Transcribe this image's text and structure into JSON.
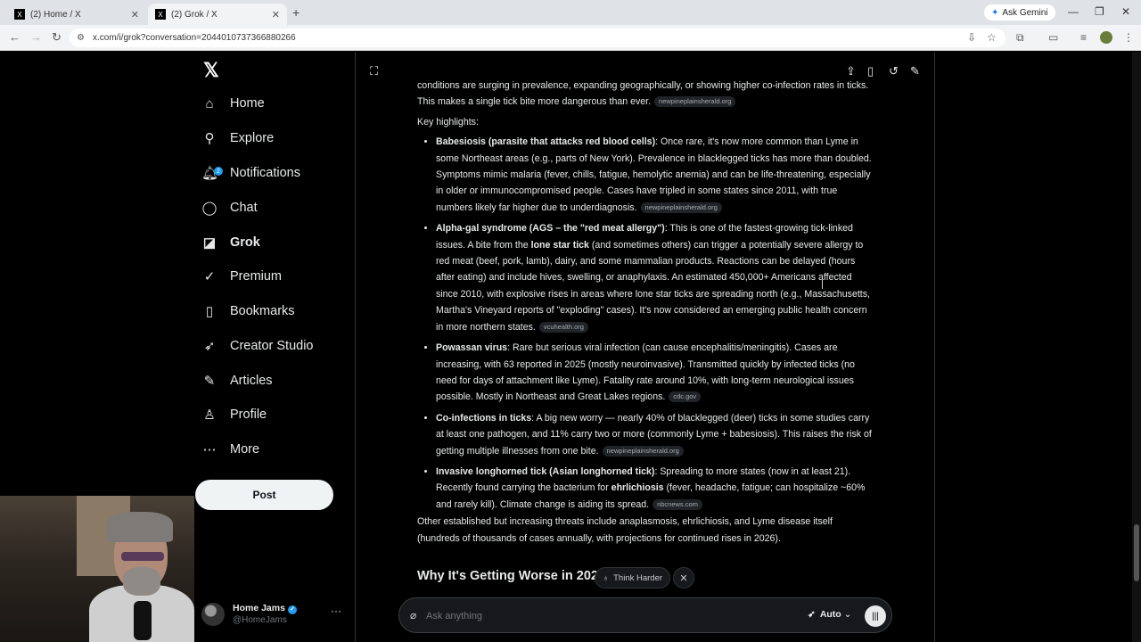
{
  "browser": {
    "tabs": [
      {
        "title": "(2) Home / X",
        "active": false
      },
      {
        "title": "(2) Grok / X",
        "active": true
      }
    ],
    "new_tab_icon": "plus-icon",
    "ask_gemini": "Ask Gemini",
    "url": "x.com/i/grok?conversation=2044010737366880266"
  },
  "sidebar": {
    "items": [
      {
        "label": "Home",
        "icon": "home-icon"
      },
      {
        "label": "Explore",
        "icon": "search-icon"
      },
      {
        "label": "Notifications",
        "icon": "bell-icon",
        "badge": "2"
      },
      {
        "label": "Chat",
        "icon": "chat-icon"
      },
      {
        "label": "Grok",
        "icon": "grok-icon"
      },
      {
        "label": "Premium",
        "icon": "premium-icon"
      },
      {
        "label": "Bookmarks",
        "icon": "bookmark-icon"
      },
      {
        "label": "Creator Studio",
        "icon": "rocket-icon"
      },
      {
        "label": "Articles",
        "icon": "article-icon"
      },
      {
        "label": "Profile",
        "icon": "person-icon"
      },
      {
        "label": "More",
        "icon": "more-icon"
      }
    ],
    "post_label": "Post",
    "profile": {
      "name": "Home Jams",
      "handle": "@HomeJams"
    }
  },
  "content": {
    "intro": "conditions are surging in prevalence, expanding geographically, or showing higher co-infection rates in ticks. This makes a single tick bite more dangerous than ever.",
    "intro_src": "newpineplainsherald.org",
    "key_highlights": "Key highlights:",
    "b1_bold": "Babesiosis (parasite that attacks red blood cells)",
    "b1_text": ": Once rare, it's now more common than Lyme in some Northeast areas (e.g., parts of New York). Prevalence in blacklegged ticks has more than doubled. Symptoms mimic malaria (fever, chills, fatigue, hemolytic anemia) and can be life-threatening, especially in older or immunocompromised people. Cases have tripled in some states since 2011, with true numbers likely far higher due to underdiagnosis.",
    "b1_src": "newpineplainsherald.org",
    "b2_bold": "Alpha-gal syndrome (AGS – the \"red meat allergy\")",
    "b2_text1": ": This is one of the fastest-growing tick-linked issues. A bite from the ",
    "b2_bold2": "lone star tick",
    "b2_text2": " (and sometimes others) can trigger a potentially severe allergy to red meat (beef, pork, lamb), dairy, and some mammalian products. Reactions can be delayed (hours after eating) and include hives, swelling, or anaphylaxis. An estimated 450,000+ Americans affected since 2010, with explosive rises in areas where lone star ticks are spreading north (e.g., Massachusetts, Martha's Vineyard reports of \"exploding\" cases). It's now considered an emerging public health concern in more northern states.",
    "b2_src": "vcuhealth.org",
    "b3_bold": "Powassan virus",
    "b3_text": ": Rare but serious viral infection (can cause encephalitis/meningitis). Cases are increasing, with 63 reported in 2025 (mostly neuroinvasive). Transmitted quickly by infected ticks (no need for days of attachment like Lyme). Fatality rate around 10%, with long-term neurological issues possible. Mostly in Northeast and Great Lakes regions.",
    "b3_src": "cdc.gov",
    "b4_bold": "Co-infections in ticks",
    "b4_text": ": A big new worry — nearly 40% of blacklegged (deer) ticks in some studies carry at least one pathogen, and 11% carry two or more (commonly Lyme + babesiosis). This raises the risk of getting multiple illnesses from one bite.",
    "b4_src": "newpineplainsherald.org",
    "b5_bold": "Invasive longhorned tick (Asian longhorned tick)",
    "b5_text1": ": Spreading to more states (now in at least 21). Recently found carrying the bacterium for ",
    "b5_bold2": "ehrlichiosis",
    "b5_text2": " (fever, headache, fatigue; can hospitalize ~60% and rarely kill). Climate change is aiding its spread.",
    "b5_src": "nbcnews.com",
    "outro": "Other established but increasing threats include anaplasmosis, ehrlichiosis, and Lyme disease itself (hundreds of thousands of cases annually, with projections for continued rises in 2026).",
    "heading": "Why It's Getting Worse in 2026"
  },
  "think_harder": "Think Harder",
  "input": {
    "placeholder": "Ask anything",
    "mode": "Auto"
  }
}
